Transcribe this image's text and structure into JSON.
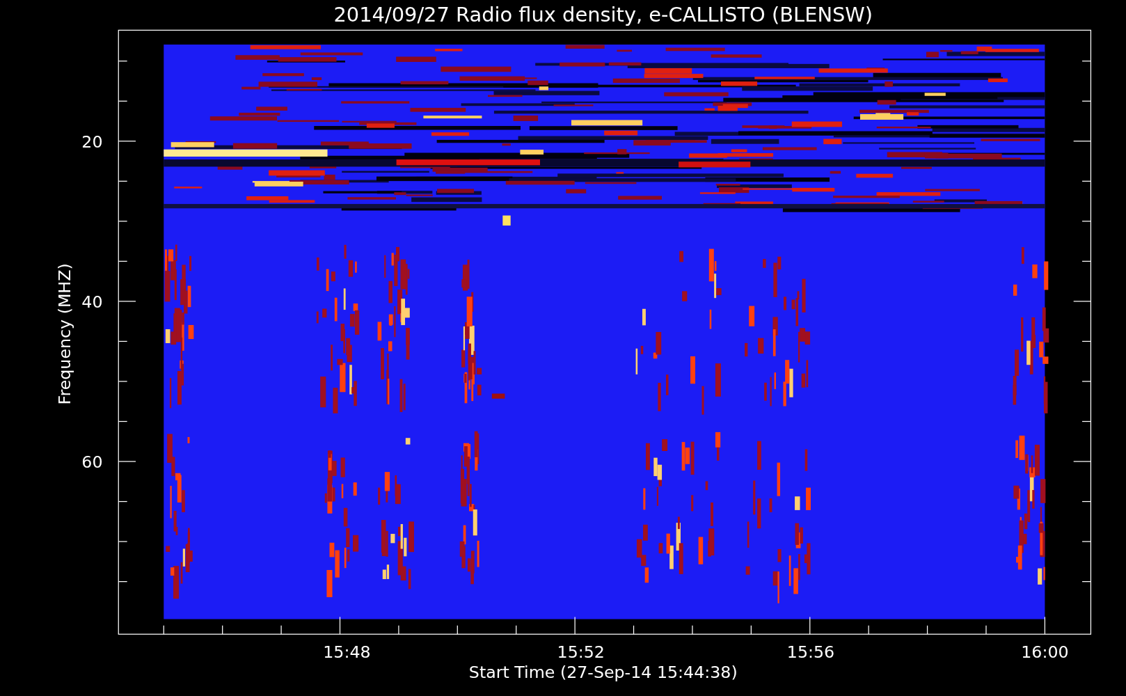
{
  "chart": {
    "title": "2014/09/27  Radio flux density, e-CALLISTO (BLENSW)",
    "ylabel": "Frequency (MHZ)",
    "xlabel": "Start Time (27-Sep-14 15:44:38)",
    "yticks": [
      "20",
      "40",
      "60"
    ],
    "xticks": [
      "15:48",
      "15:52",
      "15:56",
      "16:00"
    ]
  }
}
